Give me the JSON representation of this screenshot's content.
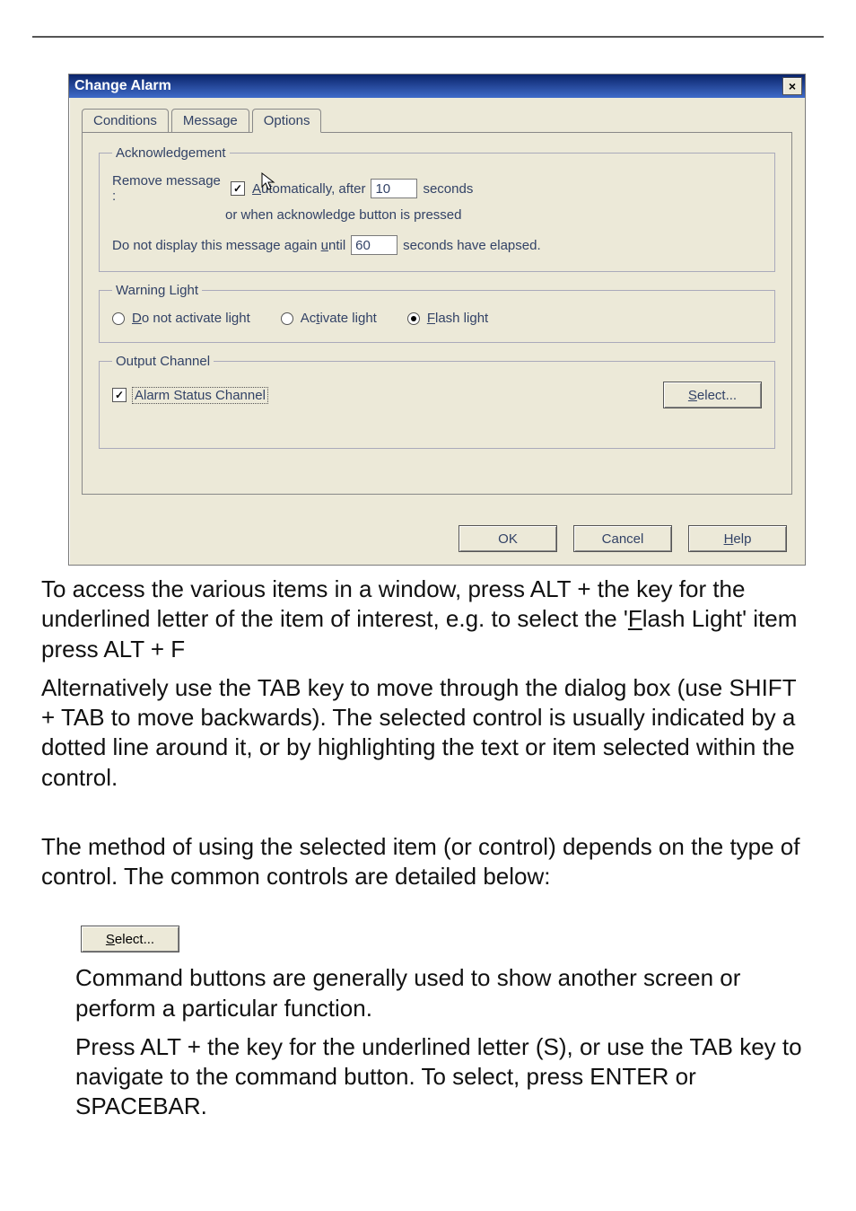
{
  "dialog": {
    "title": "Change Alarm",
    "close": "×",
    "tabs": {
      "conditions": "Conditions",
      "message": "Message",
      "options": "Options"
    },
    "ack": {
      "legend": "Acknowledgement",
      "remove": "Remove message :",
      "auto_pre": "A",
      "auto_post": "utomatically, after",
      "auto_val": "10",
      "seconds": "seconds",
      "or_line": "or when acknowledge button is pressed",
      "dnd_pre": "Do not display this message again ",
      "dnd_underline": "u",
      "dnd_post": "ntil",
      "dnd_val": "60",
      "dnd_after": "seconds have elapsed."
    },
    "warn": {
      "legend": "Warning Light",
      "opt1_u": "D",
      "opt1": "o not activate light",
      "opt2_pre": "Ac",
      "opt2_u": "t",
      "opt2_post": "ivate light",
      "opt3_u": "F",
      "opt3": "lash light"
    },
    "out": {
      "legend": "Output Channel",
      "chk": "Alarm Status Channel",
      "select_u": "S",
      "select_post": "elect..."
    },
    "buttons": {
      "ok": "OK",
      "cancel": "Cancel",
      "help_u": "H",
      "help_post": "elp"
    }
  },
  "doc": {
    "p1a": "To access the various items in a window, press ALT + the key for the underlined letter of the item of interest, e.g. to select the '",
    "p1_u": "F",
    "p1b": "lash Light' item press ALT + F",
    "p2": "Alternatively use the TAB key to move through the dialog box (use SHIFT + TAB to move backwards). The selected control is usually indicated by a dotted line around it, or by highlighting the text or item selected within the control.",
    "p3": "The method of using the selected item (or control) depends on the type of control. The common controls are detailed below:",
    "btn_u": "S",
    "btn_post": "elect...",
    "p4": "Command buttons are generally used to show another screen or perform a particular function.",
    "p5a": "Press ALT + the key for the underlined letter (",
    "p5_u": "S",
    "p5b": "), or use the TAB key to navigate to the command button. To select, press ENTER or SPACEBAR."
  }
}
